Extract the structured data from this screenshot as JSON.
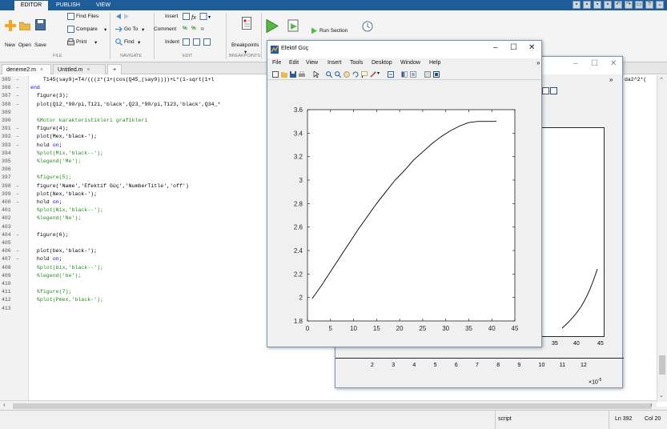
{
  "tabs": [
    "EDITOR",
    "PUBLISH",
    "VIEW"
  ],
  "ribbon": {
    "new": "New",
    "open": "Open",
    "save": "Save",
    "find_files": "Find Files",
    "compare": "Compare",
    "print": "Print",
    "goto": "Go To",
    "find": "Find",
    "insert": "Insert",
    "comment": "Comment",
    "indent": "Indent",
    "breakpoints": "Breakpoints",
    "run_section": "Run Section",
    "sections": [
      "FILE",
      "NAVIGATE",
      "EDIT",
      "BREAKPOINTS"
    ]
  },
  "editor": {
    "tabs": [
      "deneme2.m",
      "Untitled.m"
    ],
    "lines": [
      {
        "n": "385",
        "dash": "–",
        "text": "    T145(say9)=T4/(((z*(1+(cos(Q45_(say9))))+L*(1-sqrt(1+l",
        "type": "code"
      },
      {
        "n": "386",
        "dash": "–",
        "text": "end",
        "type": "keyword"
      },
      {
        "n": "387",
        "dash": "–",
        "text": "  figure(3);",
        "type": "code"
      },
      {
        "n": "388",
        "dash": "–",
        "text": "  plot(Q12_*90/pi,T121,'black',Q23_*90/pi,T123,'black',Q34_*",
        "type": "code"
      },
      {
        "n": "389",
        "dash": "",
        "text": "",
        "type": "code"
      },
      {
        "n": "390",
        "dash": "",
        "text": "  %Motor karakteristikleri grafikleri",
        "type": "comment"
      },
      {
        "n": "391",
        "dash": "–",
        "text": "  figure(4);",
        "type": "code"
      },
      {
        "n": "392",
        "dash": "–",
        "text": "  plot(Mex,'black-');",
        "type": "code"
      },
      {
        "n": "393",
        "dash": "–",
        "text": "  hold on;",
        "type": "hold"
      },
      {
        "n": "394",
        "dash": "",
        "text": "  %plot(Mix,'black--');",
        "type": "comment"
      },
      {
        "n": "395",
        "dash": "",
        "text": "  %legend('Me');",
        "type": "comment"
      },
      {
        "n": "396",
        "dash": "",
        "text": "",
        "type": "code"
      },
      {
        "n": "397",
        "dash": "",
        "text": "  %figure(5);",
        "type": "comment"
      },
      {
        "n": "398",
        "dash": "–",
        "text": "  figure('Name','Efektif Güç','NumberTitle','off')",
        "type": "code"
      },
      {
        "n": "399",
        "dash": "–",
        "text": "  plot(Nex,'black-');",
        "type": "code"
      },
      {
        "n": "400",
        "dash": "–",
        "text": "  hold on;",
        "type": "hold"
      },
      {
        "n": "401",
        "dash": "",
        "text": "  %plot(Nix,'black--');",
        "type": "comment"
      },
      {
        "n": "402",
        "dash": "",
        "text": "  %legend('Ne');",
        "type": "comment"
      },
      {
        "n": "403",
        "dash": "",
        "text": "",
        "type": "code"
      },
      {
        "n": "404",
        "dash": "–",
        "text": "  figure(6);",
        "type": "code"
      },
      {
        "n": "405",
        "dash": "",
        "text": "",
        "type": "code"
      },
      {
        "n": "406",
        "dash": "–",
        "text": "  plot(bex,'black-');",
        "type": "code"
      },
      {
        "n": "407",
        "dash": "–",
        "text": "  hold on;",
        "type": "hold"
      },
      {
        "n": "408",
        "dash": "",
        "text": "  %plot(bix,'black--');",
        "type": "comment"
      },
      {
        "n": "409",
        "dash": "",
        "text": "  %legend('be');",
        "type": "comment"
      },
      {
        "n": "410",
        "dash": "",
        "text": "",
        "type": "code"
      },
      {
        "n": "411",
        "dash": "",
        "text": "  %figure(7);",
        "type": "comment"
      },
      {
        "n": "412",
        "dash": "",
        "text": "  %plot(Pmex,'black-');",
        "type": "comment"
      },
      {
        "n": "413",
        "dash": "",
        "text": "",
        "type": "code"
      }
    ],
    "right_overflow_text": "da2^2*(",
    "script_label": "script",
    "ln": "Ln 392",
    "col": "Col 20"
  },
  "fig_front": {
    "title": "Efektif Güç",
    "menu": [
      "File",
      "Edit",
      "View",
      "Insert",
      "Tools",
      "Desktop",
      "Window",
      "Help"
    ]
  },
  "fig_back": {
    "xticks": [
      "2",
      "3",
      "4",
      "5",
      "6",
      "7",
      "8",
      "9",
      "10",
      "11",
      "12"
    ],
    "xticks_upper": [
      "35",
      "40",
      "45"
    ],
    "exponent": "×10"
  },
  "chart_data": {
    "type": "line",
    "title": "",
    "xlabel": "",
    "ylabel": "",
    "xlim": [
      0,
      45
    ],
    "ylim": [
      1.8,
      3.6
    ],
    "xticks": [
      0,
      5,
      10,
      15,
      20,
      25,
      30,
      35,
      40,
      45
    ],
    "yticks": [
      1.8,
      2,
      2.2,
      2.4,
      2.6,
      2.8,
      3,
      3.2,
      3.4,
      3.6
    ],
    "series": [
      {
        "x": [
          1,
          3,
          5,
          7,
          9,
          11,
          13,
          15,
          17,
          19,
          21,
          23,
          25,
          27,
          29,
          31,
          33,
          35,
          37,
          39,
          41
        ],
        "y": [
          1.99,
          2.1,
          2.22,
          2.34,
          2.46,
          2.58,
          2.69,
          2.8,
          2.9,
          3.0,
          3.08,
          3.17,
          3.24,
          3.31,
          3.37,
          3.42,
          3.46,
          3.49,
          3.5,
          3.5,
          3.5
        ],
        "color": "#000000"
      }
    ]
  }
}
